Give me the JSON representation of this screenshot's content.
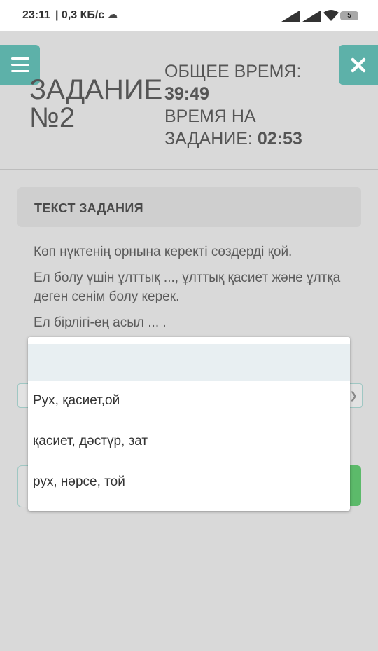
{
  "status_bar": {
    "time": "23:11",
    "network_speed": "| 0,3 КБ/с",
    "battery": "5"
  },
  "header": {
    "task_title_line1": "ЗАДАНИЕ",
    "task_title_line2": "№2",
    "total_time_label": "ОБЩЕЕ ВРЕМЯ:",
    "total_time_value": "39:49",
    "task_time_label_line1": "ВРЕМЯ НА",
    "task_time_label_line2": "ЗАДАНИЕ:",
    "task_time_value": "02:53"
  },
  "task": {
    "panel_label": "ТЕКСТ ЗАДАНИЯ",
    "instruction": "Көп нүктенің орнына керекті сөздерді қой.",
    "sentence1": "Ел болу үшін ұлттық ..., ұлттық қасиет және ұлтқа деген сенім болу керек.",
    "sentence2": "Ел бірлігі-ең асыл ... ."
  },
  "dropdown": {
    "options": [
      "",
      "Рух, қасиет,ой",
      "қасиет, дәстүр, зат",
      "рух, нәрсе, той"
    ]
  },
  "colors": {
    "accent": "#5db1a9",
    "submit": "#5cba6a",
    "background": "#d9d9d9"
  }
}
